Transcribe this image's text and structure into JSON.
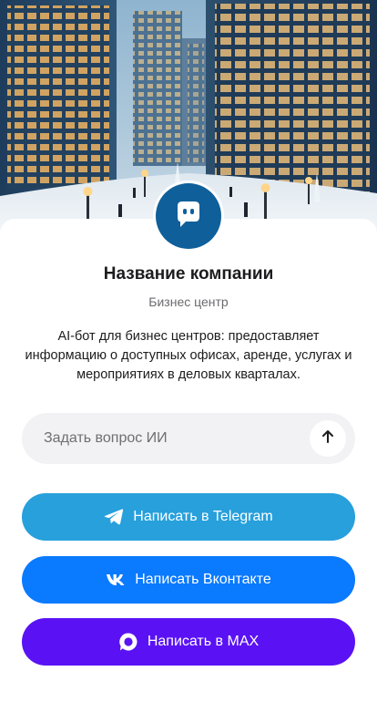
{
  "hero": {
    "image_name": "winter-business-district-illustration"
  },
  "company": {
    "avatar_icon": "chat-bot-icon",
    "name": "Название компании",
    "type": "Бизнес центр",
    "description": "AI-бот для бизнес центров: предоставляет информацию о доступных офисах, аренде, услугах и мероприятиях в деловых кварталах."
  },
  "ask": {
    "placeholder": "Задать вопрос ИИ",
    "value": "",
    "send_icon": "arrow-up-icon"
  },
  "buttons": {
    "telegram": {
      "label": "Написать в Telegram",
      "icon": "telegram-icon",
      "color": "#27a0dc"
    },
    "vkontakte": {
      "label": "Написать Вконтакте",
      "icon": "vk-icon",
      "color": "#0a7aff"
    },
    "max": {
      "label": "Написать в MAX",
      "icon": "max-icon",
      "color": "#5a12f5"
    }
  },
  "colors": {
    "avatar": "#0f5f9a",
    "input_background": "#f2f2f4"
  }
}
